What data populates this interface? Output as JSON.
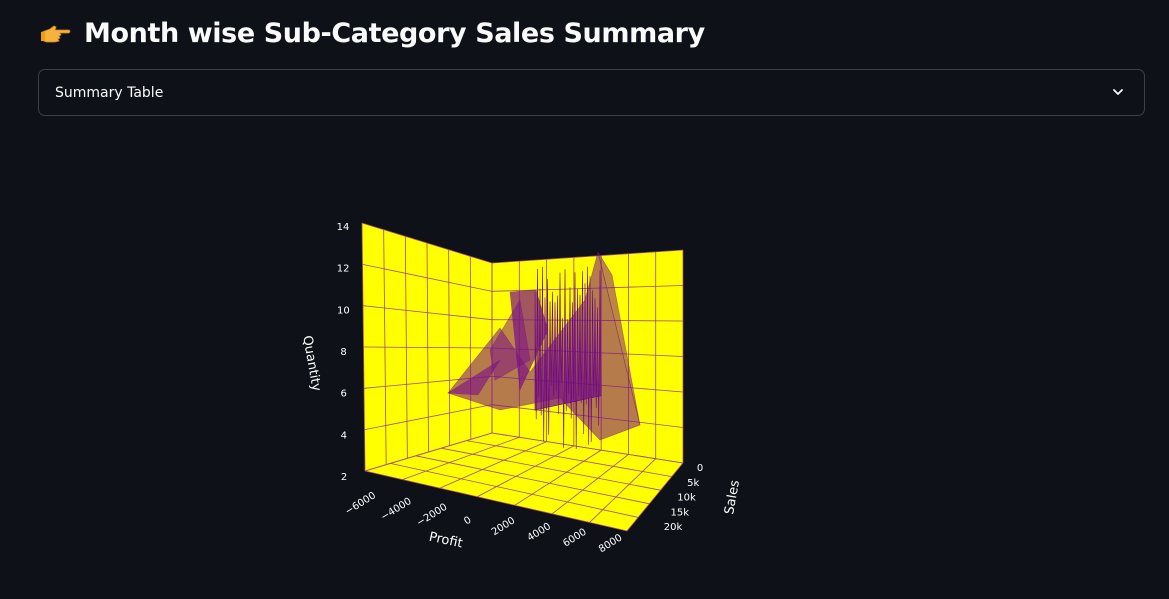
{
  "header": {
    "emoji_icon": "pointing-right-hand-icon",
    "title": "Month wise Sub-Category Sales Summary"
  },
  "expander": {
    "label": "Summary Table",
    "icon": "chevron-down-icon",
    "expanded": false
  },
  "chart_data": {
    "type": "3d-mesh",
    "title": "",
    "colors": {
      "plane_fill": "#ffff00",
      "grid": "#a24a7a",
      "mesh": "#7a0f86",
      "axis_text": "#ffffff"
    },
    "x_axis": {
      "label": "Profit",
      "ticks": [
        "−6000",
        "−4000",
        "−2000",
        "0",
        "2000",
        "4000",
        "6000",
        "8000"
      ],
      "range": [
        -6000,
        8000
      ]
    },
    "y_axis": {
      "label": "Sales",
      "ticks": [
        "0",
        "5k",
        "10k",
        "15k",
        "20k"
      ],
      "range": [
        0,
        20000
      ]
    },
    "z_axis": {
      "label": "Quantity",
      "ticks": [
        "2",
        "4",
        "6",
        "8",
        "10",
        "12",
        "14"
      ],
      "range": [
        2,
        14
      ]
    }
  }
}
